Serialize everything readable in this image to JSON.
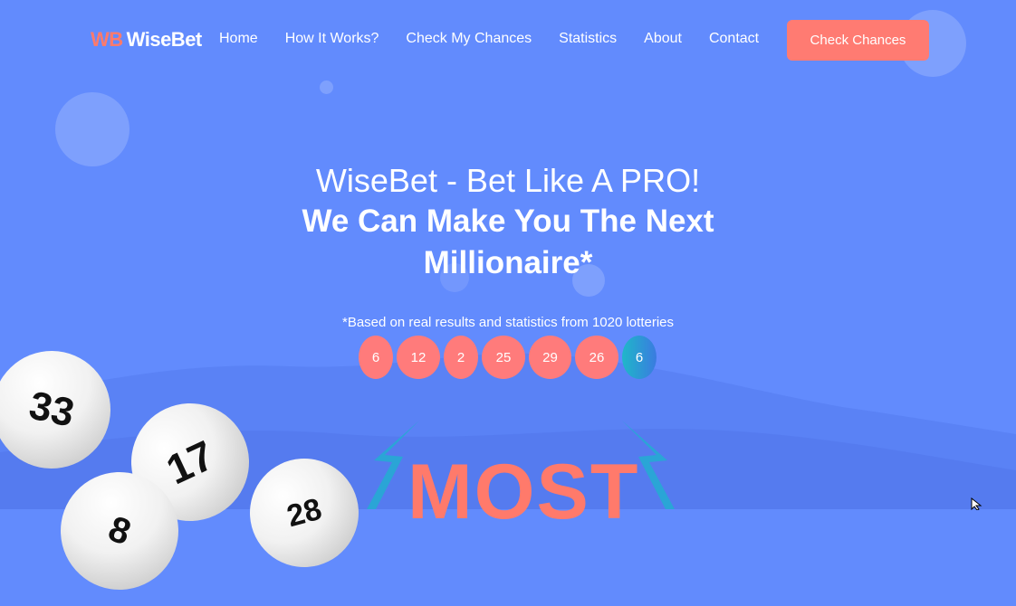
{
  "brand": {
    "logo_mark": "WB",
    "logo_text": "WiseBet"
  },
  "nav": {
    "items": [
      {
        "label": "Home"
      },
      {
        "label": "How It Works?"
      },
      {
        "label": "Check My Chances"
      },
      {
        "label": "Statistics"
      },
      {
        "label": "About"
      },
      {
        "label": "Contact"
      }
    ],
    "cta_label": "Check Chances"
  },
  "hero": {
    "title_line1": "WiseBet - Bet Like A PRO!",
    "title_line2": "We Can Make You The Next Millionaire*",
    "footnote": "*Based on real results and statistics from 1020 lotteries"
  },
  "numbers": [
    "6",
    "12",
    "2",
    "25",
    "29",
    "26"
  ],
  "bonus_number": "6",
  "lotto_balls": [
    "33",
    "17",
    "8",
    "28"
  ],
  "promo_text": "MOST",
  "colors": {
    "background": "#628bfd",
    "accent": "#ff7b72",
    "bonus": "#1fb7c9"
  }
}
